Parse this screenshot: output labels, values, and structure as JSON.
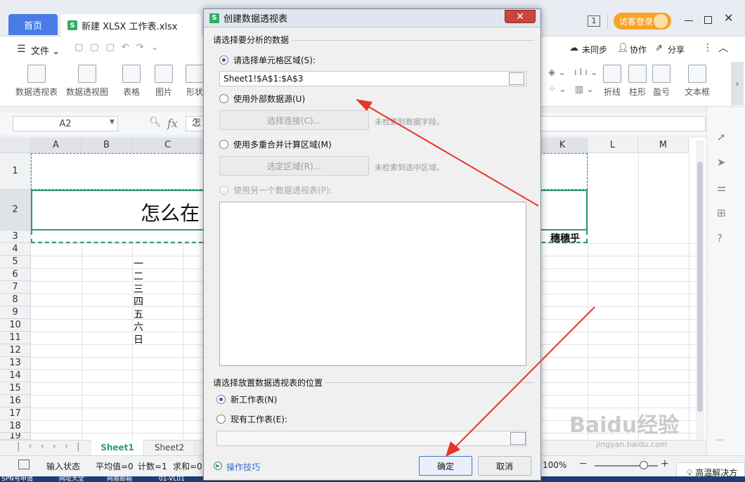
{
  "titlebar": {
    "home_tab": "首页",
    "file_tab": "新建 XLSX 工作表.xlsx",
    "file_icon": "S",
    "page_indicator": "1",
    "login_label": "访客登录"
  },
  "menubar": {
    "file_menu": "文件",
    "unsync": "未同步",
    "collab": "协作",
    "share": "分享"
  },
  "ribbon": {
    "items": [
      "数据透视表",
      "数据透视图",
      "表格",
      "图片",
      "形状"
    ],
    "right_items": [
      "折线",
      "柱形",
      "盈亏",
      "文本框"
    ]
  },
  "formula": {
    "namebox": "A2",
    "fx": "fx",
    "content": "怎"
  },
  "grid": {
    "columns": [
      "A",
      "B",
      "C",
      "K",
      "L",
      "M"
    ],
    "rows": [
      "1",
      "2",
      "3",
      "4",
      "5",
      "6",
      "7",
      "8",
      "9",
      "10",
      "11",
      "12",
      "13",
      "14",
      "15",
      "16",
      "17",
      "18",
      "19"
    ],
    "title_text": "怎么在",
    "k3_text": "穗穗乎",
    "weekdays": [
      "一",
      "二",
      "三",
      "四",
      "五",
      "六",
      "日"
    ]
  },
  "sheet_tabs": {
    "active": "Sheet1",
    "other": "Sheet2"
  },
  "status": {
    "input_state": "输入状态",
    "average": "平均值=0",
    "count": "计数=1",
    "sum": "求和=0",
    "zoom": "100%",
    "notify": "高温解决方"
  },
  "taskbar": {
    "items": [
      "SPN号申请",
      "网址大全",
      "网易邮箱",
      "01-VL01"
    ]
  },
  "dialog": {
    "title": "创建数据透视表",
    "icon": "S",
    "group1_label": "请选择要分析的数据",
    "opt_range": "请选择单元格区域(S):",
    "range_value": "Sheet1!$A$1:$A$3",
    "opt_external": "使用外部数据源(U)",
    "btn_select_conn": "选择连接(C)...",
    "hint_conn": "未检索到数据字段。",
    "opt_multi": "使用多重合并计算区域(M)",
    "btn_select_area": "选定区域(R)...",
    "hint_area": "未检索到选中区域。",
    "opt_another": "使用另一个数据透视表(P):",
    "group2_label": "请选择放置数据透视表的位置",
    "opt_new_sheet": "新工作表(N)",
    "opt_existing": "现有工作表(E):",
    "existing_value": "",
    "tips_link": "操作技巧",
    "ok": "确定",
    "cancel": "取消"
  },
  "watermark": {
    "text": "Baidu经验",
    "url": "jingyan.baidu.com"
  },
  "colors": {
    "accent_blue": "#4a7ce8",
    "selection_green": "#2e9e6a",
    "arrow_red": "#e8342c",
    "login_orange": "#f7a326"
  }
}
